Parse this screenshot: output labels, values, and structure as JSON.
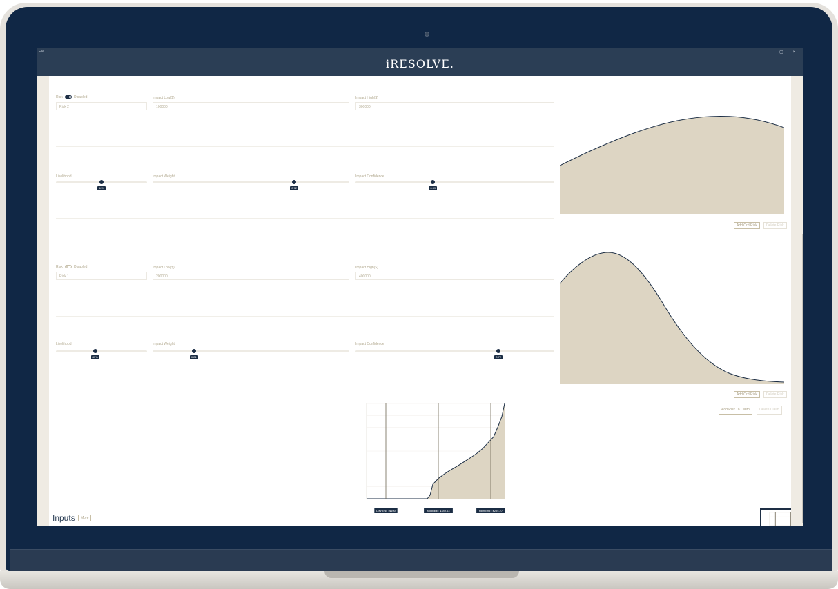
{
  "app": {
    "brand": "iRESOLVE.",
    "menu_file": "File",
    "window_controls": "– ▢ ×"
  },
  "risks": [
    {
      "risk_label": "Risk",
      "toggle_on": true,
      "status": "Disabled",
      "name": "Risk 2",
      "impact_low_label": "Impact Low($)",
      "impact_low": "100000",
      "impact_high_label": "Impact High($)",
      "impact_high": "300000",
      "likelihood_label": "Likelihood",
      "likelihood": "56%",
      "likelihood_pct": 0.5,
      "impact_weight_label": "Impact Weight",
      "impact_weight": "0.72",
      "impact_weight_pct": 0.72,
      "impact_confidence_label": "Impact Confidence",
      "impact_confidence": "0.39",
      "impact_confidence_pct": 0.39,
      "add_label": "Add Ord Risk",
      "delete_label": "Delete Risk"
    },
    {
      "risk_label": "Risk",
      "toggle_on": false,
      "status": "Disabled",
      "name": "Risk 1",
      "impact_low_label": "Impact Low($)",
      "impact_low": "200000",
      "impact_high_label": "Impact High($)",
      "impact_high": "400000",
      "likelihood_label": "Likelihood",
      "likelihood": "43%",
      "likelihood_pct": 0.43,
      "impact_weight_label": "Impact Weight",
      "impact_weight": "0.21",
      "impact_weight_pct": 0.21,
      "impact_confidence_label": "Impact Confidence",
      "impact_confidence": "0.72",
      "impact_confidence_pct": 0.72,
      "add_label": "Add Ord Risk",
      "delete_label": "Delete Risk"
    }
  ],
  "claim_buttons": {
    "add_risk_to_claim": "Add Risk To Claim",
    "delete_claim": "Delete Claim"
  },
  "summary": {
    "low_end": "Low End : $100",
    "midpoint": "Midpoint : $189.63",
    "high_end": "High End : $294.27"
  },
  "inputs": {
    "title": "Inputs",
    "more": "More"
  },
  "colors": {
    "navy": "#102745",
    "titlebar": "#2b3e55",
    "fill": "#ddd5c3",
    "accent_text": "#b2a98f"
  },
  "chart_data": {
    "type": "area",
    "title": "",
    "x_range": [
      0,
      100
    ],
    "y_range": [
      0,
      800
    ],
    "points": [
      [
        0,
        0
      ],
      [
        10,
        0
      ],
      [
        20,
        0
      ],
      [
        30,
        0
      ],
      [
        40,
        0
      ],
      [
        44,
        0
      ],
      [
        46,
        30
      ],
      [
        48,
        120
      ],
      [
        52,
        170
      ],
      [
        56,
        205
      ],
      [
        60,
        235
      ],
      [
        64,
        262
      ],
      [
        68,
        290
      ],
      [
        72,
        320
      ],
      [
        76,
        350
      ],
      [
        80,
        382
      ],
      [
        84,
        420
      ],
      [
        88,
        470
      ],
      [
        92,
        520
      ],
      [
        95,
        600
      ],
      [
        98,
        690
      ],
      [
        100,
        800
      ]
    ],
    "markers": [
      {
        "x": 14,
        "label": "Low End : $100"
      },
      {
        "x": 52,
        "label": "Midpoint : $189.63"
      },
      {
        "x": 90,
        "label": "High End : $294.27"
      }
    ]
  }
}
